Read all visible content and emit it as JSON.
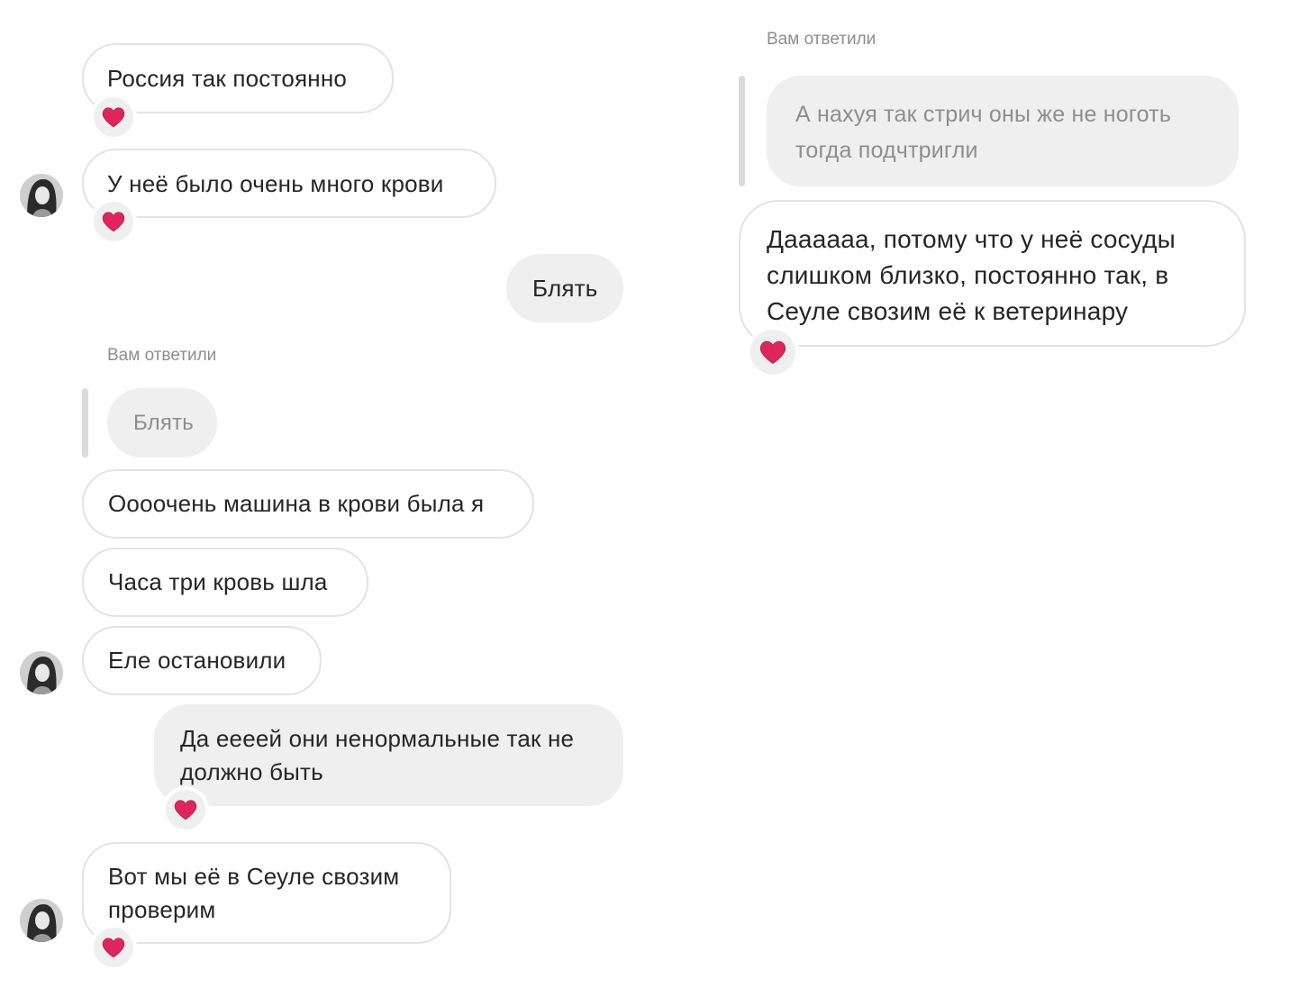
{
  "left_column": {
    "messages": [
      {
        "text": "Россия так постоянно",
        "reaction": "❤️"
      },
      {
        "text": "У неё было очень много крови",
        "reaction": "❤️"
      },
      {
        "text": "Блять"
      },
      {
        "reply_label": "Вам ответили",
        "quoted": "Блять"
      },
      {
        "text": "Оооочень машина в крови была я"
      },
      {
        "text": "Часа три кровь шла"
      },
      {
        "text": "Еле остановили"
      },
      {
        "text_line1": "Да еееей они ненормальные так не",
        "text_line2": "должно быть",
        "reaction": "❤️"
      },
      {
        "text_line1": "Вот мы её в Сеуле свозим",
        "text_line2": "проверим",
        "reaction": "❤️"
      }
    ]
  },
  "right_column": {
    "reply_label": "Вам ответили",
    "quoted_line1": "А нахуя так стрич оны же не ноготь",
    "quoted_line2": "тогда подчтригли",
    "reply_line1": "Даааааа, потому что у неё сосуды",
    "reply_line2": "слишком близко, постоянно так, в",
    "reply_line3": "Сеуле свозим её к ветеринару",
    "reaction": "❤️"
  },
  "icons": {
    "reaction": "heart-icon",
    "avatar": "user-avatar"
  },
  "colors": {
    "incoming_border": "#e3e3e3",
    "outgoing_bg": "#efefef",
    "secondary_text": "#8e8e8e",
    "heart": "#e0245e"
  }
}
